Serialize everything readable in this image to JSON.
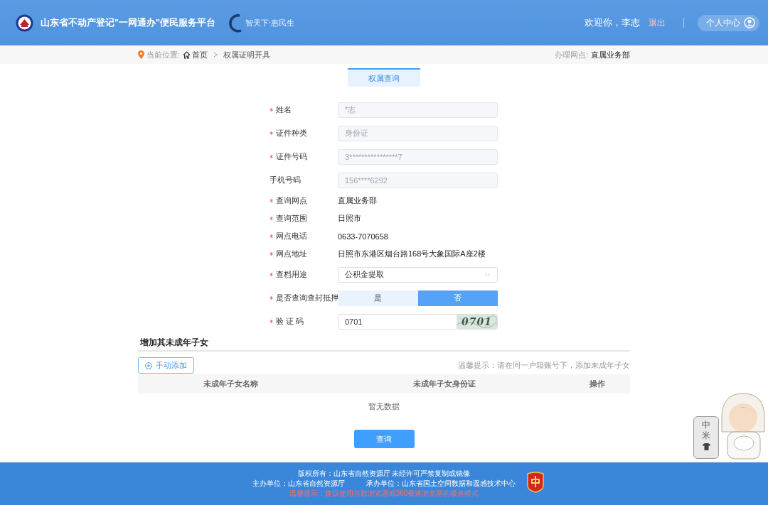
{
  "header": {
    "title": "山东省不动产登记\"一网通办\"便民服务平台",
    "slogan": "智天下·惠民生",
    "welcome": "欢迎你，李志",
    "logout": "退出",
    "user_center": "个人中心"
  },
  "breadcrumb": {
    "label": "当前位置:",
    "items": [
      "首页",
      "权属证明开具"
    ],
    "office_label": "办理网点:",
    "office": "直属业务部"
  },
  "tabs": [
    {
      "label": "权属查询",
      "selected": true
    }
  ],
  "form": [
    {
      "kind": "input",
      "label": "姓名",
      "required": true,
      "value": "*志",
      "disabled": true
    },
    {
      "kind": "input",
      "label": "证件种类",
      "required": true,
      "value": "身份证",
      "disabled": true
    },
    {
      "kind": "input",
      "label": "证件号码",
      "required": true,
      "value": "3****************7",
      "disabled": true
    },
    {
      "kind": "input",
      "label": "手机号码",
      "required": false,
      "value": "156****6292",
      "disabled": true
    },
    {
      "kind": "text",
      "label": "查询网点",
      "required": true,
      "value": "直属业务部"
    },
    {
      "kind": "text",
      "label": "查询范围",
      "required": true,
      "value": "日照市"
    },
    {
      "kind": "text",
      "label": "网点电话",
      "required": true,
      "value": "0633-7070658"
    },
    {
      "kind": "text",
      "label": "网点地址",
      "required": true,
      "value": "日照市东港区烟台路168号大象国际A座2楼"
    },
    {
      "kind": "select",
      "label": "查档用途",
      "required": true,
      "value": "公积金提取"
    },
    {
      "kind": "toggle",
      "label": "是否查询查封抵押",
      "required": true,
      "options": [
        {
          "label": "是",
          "selected": false
        },
        {
          "label": "否",
          "selected": true
        }
      ]
    },
    {
      "kind": "captcha",
      "label": "验 证 码",
      "required": true,
      "value": "0701",
      "captcha": "0701"
    }
  ],
  "children_section": {
    "title": "增加其未成年子女",
    "add_button": "手动添加",
    "tip": "温馨提示：请在同一户籍账号下，添加未成年子女",
    "columns": [
      "未成年子女名称",
      "未成年子女身份证",
      "操作"
    ],
    "empty": "暂无数据"
  },
  "submit": "查询",
  "footer": {
    "copyright": "版权所有：山东省自然资源厅 未经许可严禁复制或镜像",
    "sponsor": "主办单位：山东省自然资源厅",
    "organizer": "承办单位：山东省国土空间数据和遥感技术中心",
    "warning": "温馨提示：建议使用谷歌浏览器或360极速浏览器的极速模式"
  },
  "widget": {
    "chars": [
      "中",
      "米"
    ]
  }
}
